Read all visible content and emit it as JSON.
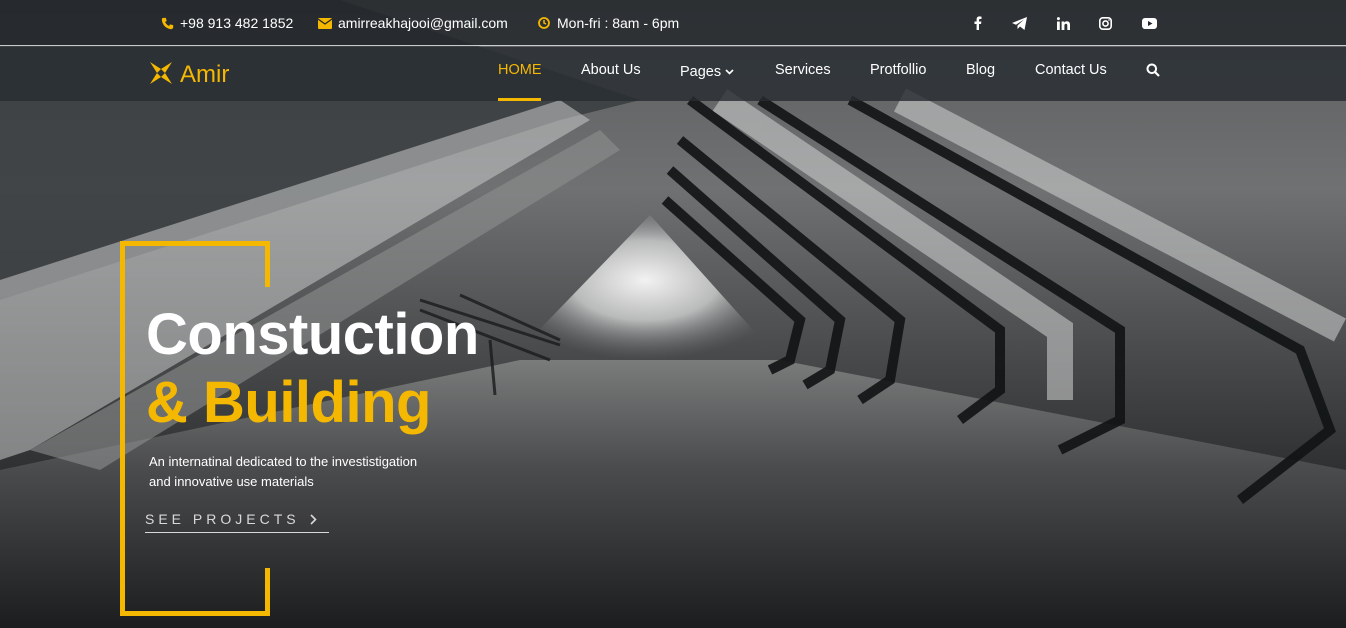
{
  "topbar": {
    "phone": "+98 913 482 1852",
    "email": "amirreakhajooi@gmail.com",
    "hours": "Mon-fri : 8am - 6pm",
    "social": [
      "facebook-icon",
      "telegram-icon",
      "linkedin-icon",
      "instagram-icon",
      "youtube-icon"
    ]
  },
  "brand": {
    "name": "Amir"
  },
  "nav": {
    "items": [
      {
        "label": "HOME",
        "active": true
      },
      {
        "label": "About Us"
      },
      {
        "label": "Pages",
        "has_dropdown": true
      },
      {
        "label": "Services"
      },
      {
        "label": "Protfollio"
      },
      {
        "label": "Blog"
      },
      {
        "label": "Contact Us"
      }
    ],
    "search_icon": "search-icon"
  },
  "hero": {
    "title_line1": "Constuction",
    "title_line2": "& Building",
    "description_line1": "An internatinal dedicated to the investistigation",
    "description_line2": "and innovative use materials",
    "cta": "SEE PROJECTS",
    "cta_icon": "chevron-right-icon"
  },
  "colors": {
    "accent": "#f5b800",
    "bar_bg": "#23272b",
    "text": "#ffffff"
  }
}
